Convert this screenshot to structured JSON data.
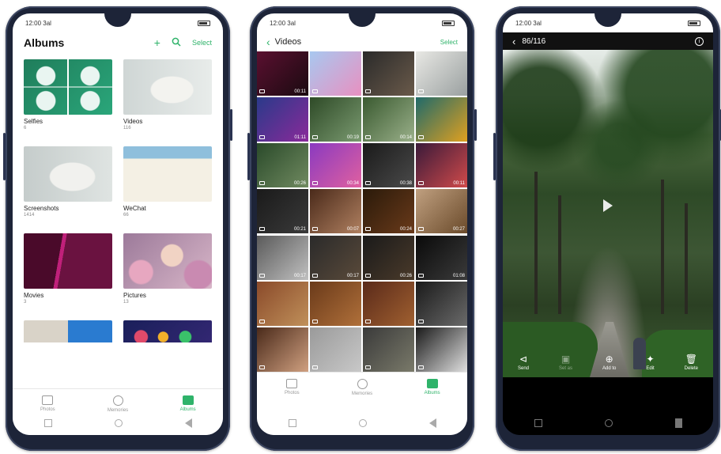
{
  "status": {
    "time": "12:00 3al"
  },
  "albums": {
    "title": "Albums",
    "add_icon": "+",
    "select": "Select",
    "items": [
      {
        "name": "Selfies",
        "count": "6"
      },
      {
        "name": "Videos",
        "count": "116"
      },
      {
        "name": "Screenshots",
        "count": "1414"
      },
      {
        "name": "WeChat",
        "count": "66"
      },
      {
        "name": "Movies",
        "count": "3"
      },
      {
        "name": "Pictures",
        "count": "13"
      },
      {
        "name": "",
        "count": ""
      },
      {
        "name": "",
        "count": ""
      }
    ],
    "tabs": [
      {
        "label": "Photos",
        "icon": "photos-icon"
      },
      {
        "label": "Memories",
        "icon": "memories-icon"
      },
      {
        "label": "Albums",
        "icon": "albums-icon"
      }
    ]
  },
  "videos": {
    "title": "Videos",
    "select": "Select",
    "durations": [
      "00:11",
      "",
      "",
      "",
      "01:11",
      "00:19",
      "00:14",
      "",
      "00:26",
      "00:34",
      "00:38",
      "00:11",
      "00:21",
      "00:07",
      "00:24",
      "00:27",
      "00:17",
      "00:17",
      "00:26",
      "01:08",
      "",
      "",
      "",
      "",
      "",
      "",
      "",
      ""
    ],
    "tabs": [
      {
        "label": "Photos",
        "icon": "photos-icon"
      },
      {
        "label": "Memories",
        "icon": "memories-icon"
      },
      {
        "label": "Albums",
        "icon": "albums-icon"
      }
    ]
  },
  "viewer": {
    "counter": "86/116",
    "info_icon": "i",
    "tools": [
      {
        "label": "Send",
        "icon": "share-icon"
      },
      {
        "label": "Set as",
        "icon": "set-as-icon"
      },
      {
        "label": "Add to",
        "icon": "add-to-icon"
      },
      {
        "label": "Edit",
        "icon": "edit-icon"
      },
      {
        "label": "Delete",
        "icon": "delete-icon"
      }
    ]
  },
  "colors": {
    "accent": "#2fb36a",
    "frame": "#1d2438"
  }
}
